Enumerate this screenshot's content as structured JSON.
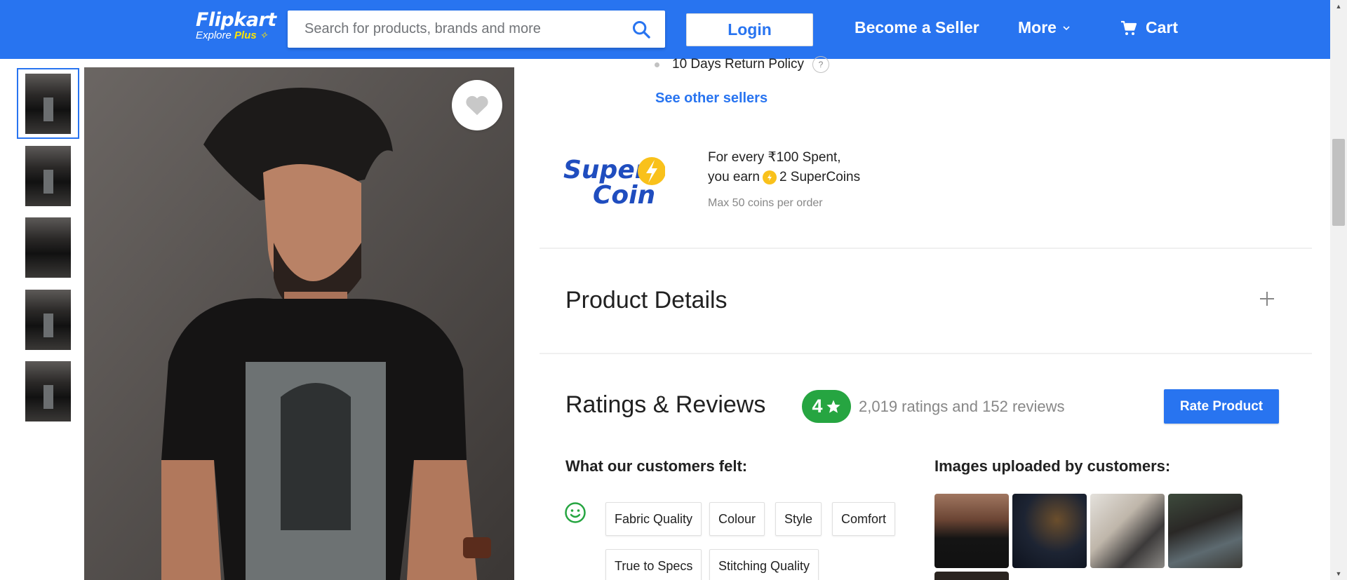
{
  "header": {
    "logo": "Flipkart",
    "logo_sub": "Explore",
    "logo_plus": "Plus",
    "search_placeholder": "Search for products, brands and more",
    "login_label": "Login",
    "seller_label": "Become a Seller",
    "more_label": "More",
    "cart_label": "Cart",
    "brand_color": "#2874f0"
  },
  "gallery": {
    "thumbnail_count": 5,
    "active_thumbnail": 1
  },
  "seller": {
    "return_policy": "10 Days Return Policy",
    "help_label": "?",
    "other_sellers_label": "See other sellers"
  },
  "supercoin": {
    "logo_word1": "Super",
    "logo_word2": "Coin",
    "line1": "For every ₹100 Spent,",
    "line2_prefix": "you earn",
    "line2_suffix": "2 SuperCoins",
    "note": "Max 50 coins per order"
  },
  "product_details": {
    "title": "Product Details"
  },
  "ratings": {
    "title": "Ratings & Reviews",
    "average": "4",
    "summary": "2,019 ratings and 152 reviews",
    "rate_button": "Rate Product",
    "badge_color": "#26a541",
    "felt_heading": "What our customers felt:",
    "tags": [
      "Fabric Quality",
      "Colour",
      "Style",
      "Comfort",
      "True to Specs",
      "Stitching Quality"
    ],
    "images_heading": "Images uploaded by customers:"
  }
}
